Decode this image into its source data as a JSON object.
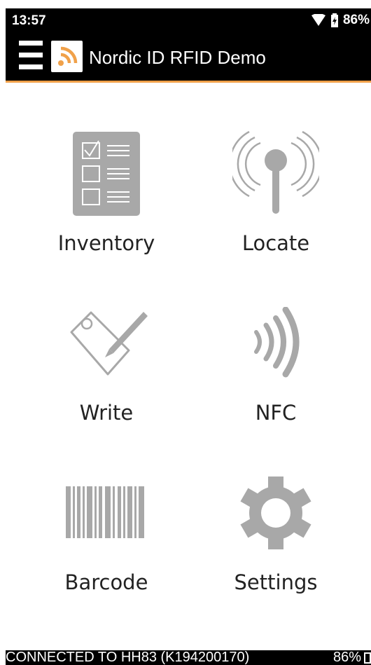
{
  "status_bar": {
    "time": "13:57",
    "battery": "86%"
  },
  "app_bar": {
    "title": "Nordic ID RFID Demo"
  },
  "menu": [
    {
      "id": "inventory",
      "label": "Inventory",
      "icon": "checklist-icon"
    },
    {
      "id": "locate",
      "label": "Locate",
      "icon": "antenna-icon"
    },
    {
      "id": "write",
      "label": "Write",
      "icon": "tag-write-icon"
    },
    {
      "id": "nfc",
      "label": "NFC",
      "icon": "nfc-icon"
    },
    {
      "id": "barcode",
      "label": "Barcode",
      "icon": "barcode-icon"
    },
    {
      "id": "settings",
      "label": "Settings",
      "icon": "gear-icon"
    }
  ],
  "footer": {
    "connection": "CONNECTED TO HH83 (K194200170)",
    "battery": "86%"
  },
  "colors": {
    "accent": "#f0a14a",
    "icon_gray": "#a8a8a8",
    "bar": "#000000"
  }
}
